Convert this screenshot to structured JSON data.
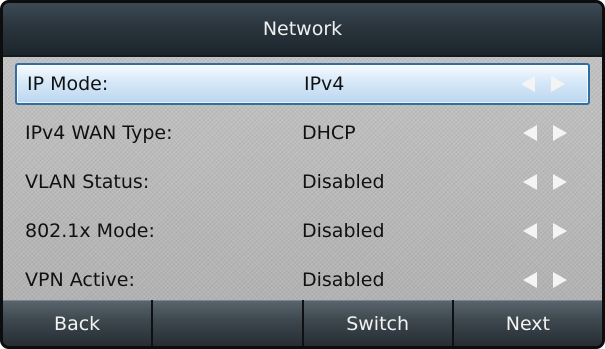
{
  "screen_title": "Network",
  "rows": [
    {
      "label": "IP Mode:",
      "value": "IPv4",
      "selected": true
    },
    {
      "label": "IPv4 WAN Type:",
      "value": "DHCP",
      "selected": false
    },
    {
      "label": "VLAN Status:",
      "value": "Disabled",
      "selected": false
    },
    {
      "label": "802.1x Mode:",
      "value": "Disabled",
      "selected": false
    },
    {
      "label": "VPN Active:",
      "value": "Disabled",
      "selected": false
    }
  ],
  "softkeys": [
    "Back",
    "",
    "Switch",
    "Next"
  ],
  "icons": {
    "left": "arrow-left-icon",
    "right": "arrow-right-icon"
  },
  "colors": {
    "selection_border": "#2f6fa6",
    "arrow": "#f4f4f4",
    "title_bg": "#2a353d"
  }
}
